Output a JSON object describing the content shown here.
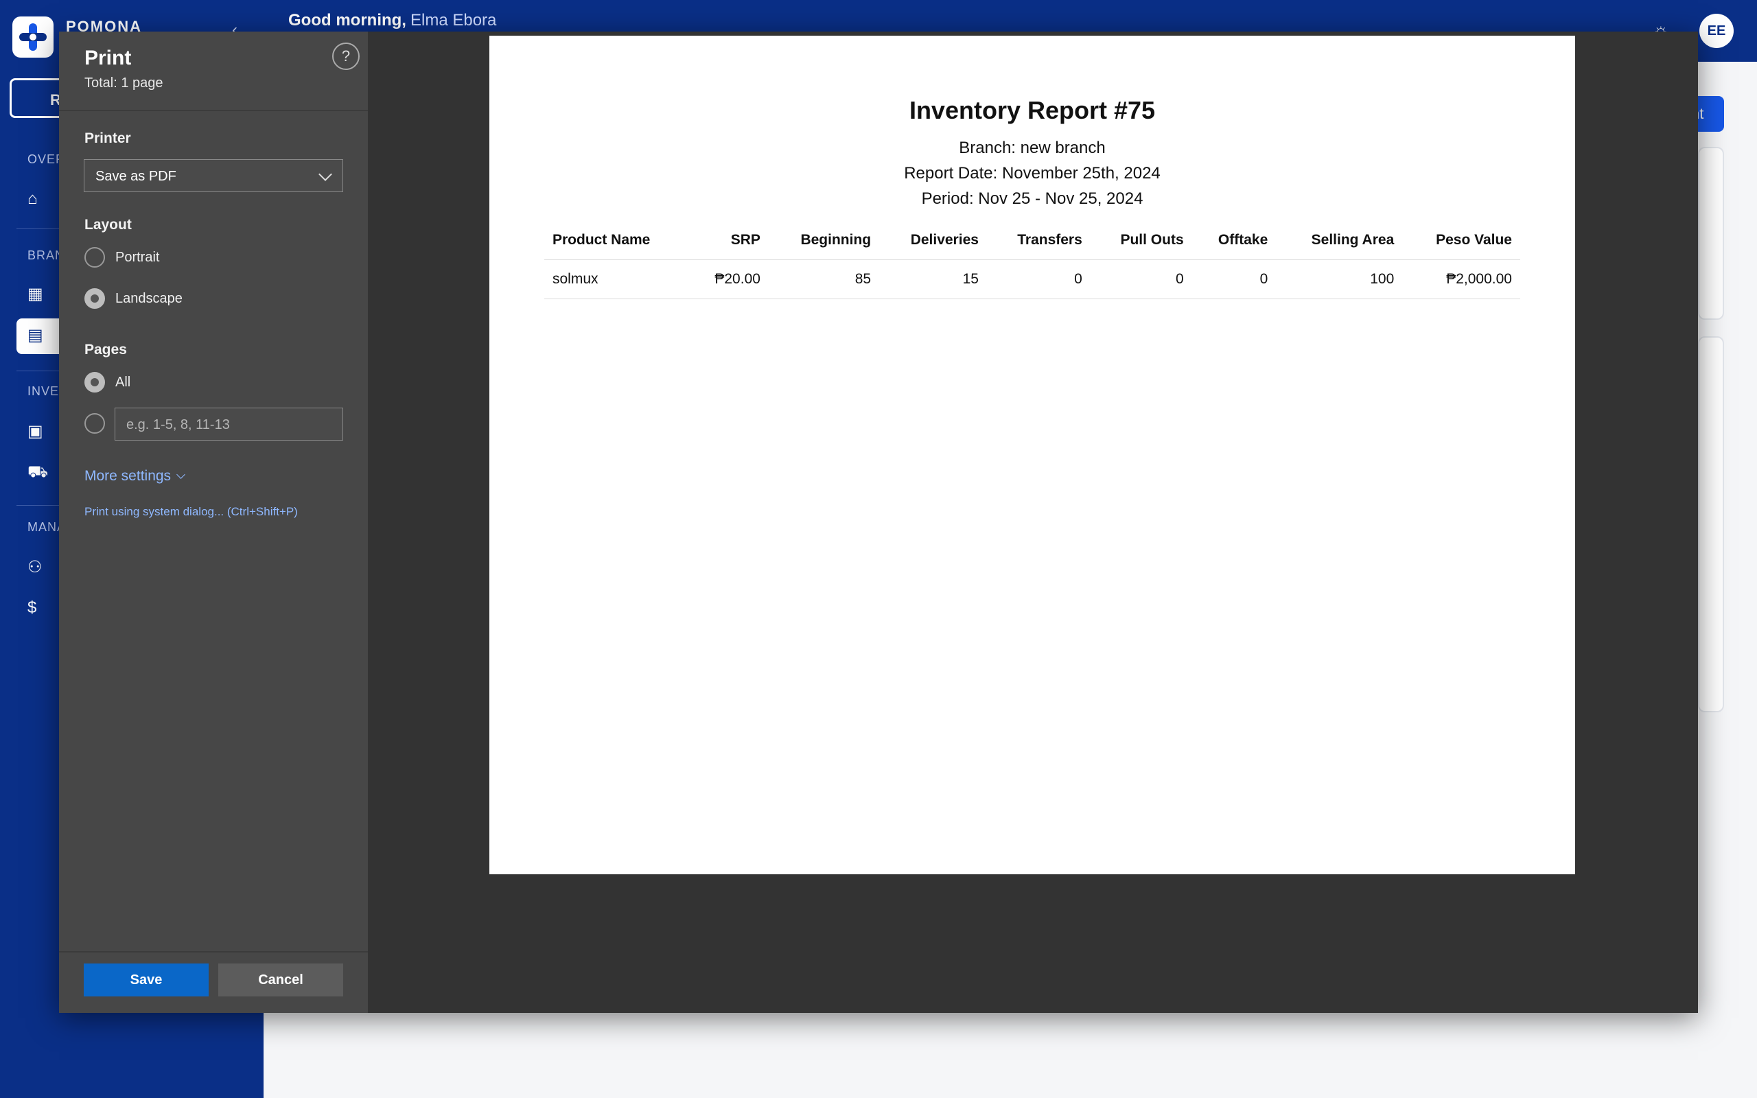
{
  "app": {
    "brand": "POMONA",
    "greeting": "Good morning,",
    "user_name": "Elma Ebora",
    "avatar_initials": "EE",
    "sidebar_button_label": "R",
    "sidebar_sections": [
      "OVER",
      "BRAN",
      "INVE",
      "MANA"
    ],
    "primary_button_partial": "nt",
    "colors": {
      "brand_blue": "#0a2f87",
      "button_blue": "#1757e6"
    }
  },
  "print": {
    "title": "Print",
    "total": "Total: 1 page",
    "help": "?",
    "printer_label": "Printer",
    "printer_value": "Save as PDF",
    "layout_label": "Layout",
    "layout_options": [
      "Portrait",
      "Landscape"
    ],
    "layout_selected": "Landscape",
    "pages_label": "Pages",
    "pages_all": "All",
    "pages_placeholder": "e.g. 1-5, 8, 11-13",
    "more_settings": "More settings",
    "system_dialog": "Print using system dialog... (Ctrl+Shift+P)",
    "save": "Save",
    "cancel": "Cancel",
    "colors": {
      "panel_bg": "#474747",
      "preview_bg": "#333333",
      "save_btn": "#0a67c8",
      "link": "#8fb8ff"
    }
  },
  "report": {
    "title": "Inventory Report #75",
    "branch": "Branch: new branch",
    "report_date": "Report Date: November 25th, 2024",
    "period": "Period: Nov 25 - Nov 25, 2024",
    "columns": [
      "Product Name",
      "SRP",
      "Beginning",
      "Deliveries",
      "Transfers",
      "Pull Outs",
      "Offtake",
      "Selling Area",
      "Peso Value"
    ],
    "rows": [
      [
        "solmux",
        "₱20.00",
        "85",
        "15",
        "0",
        "0",
        "0",
        "100",
        "₱2,000.00"
      ]
    ]
  }
}
